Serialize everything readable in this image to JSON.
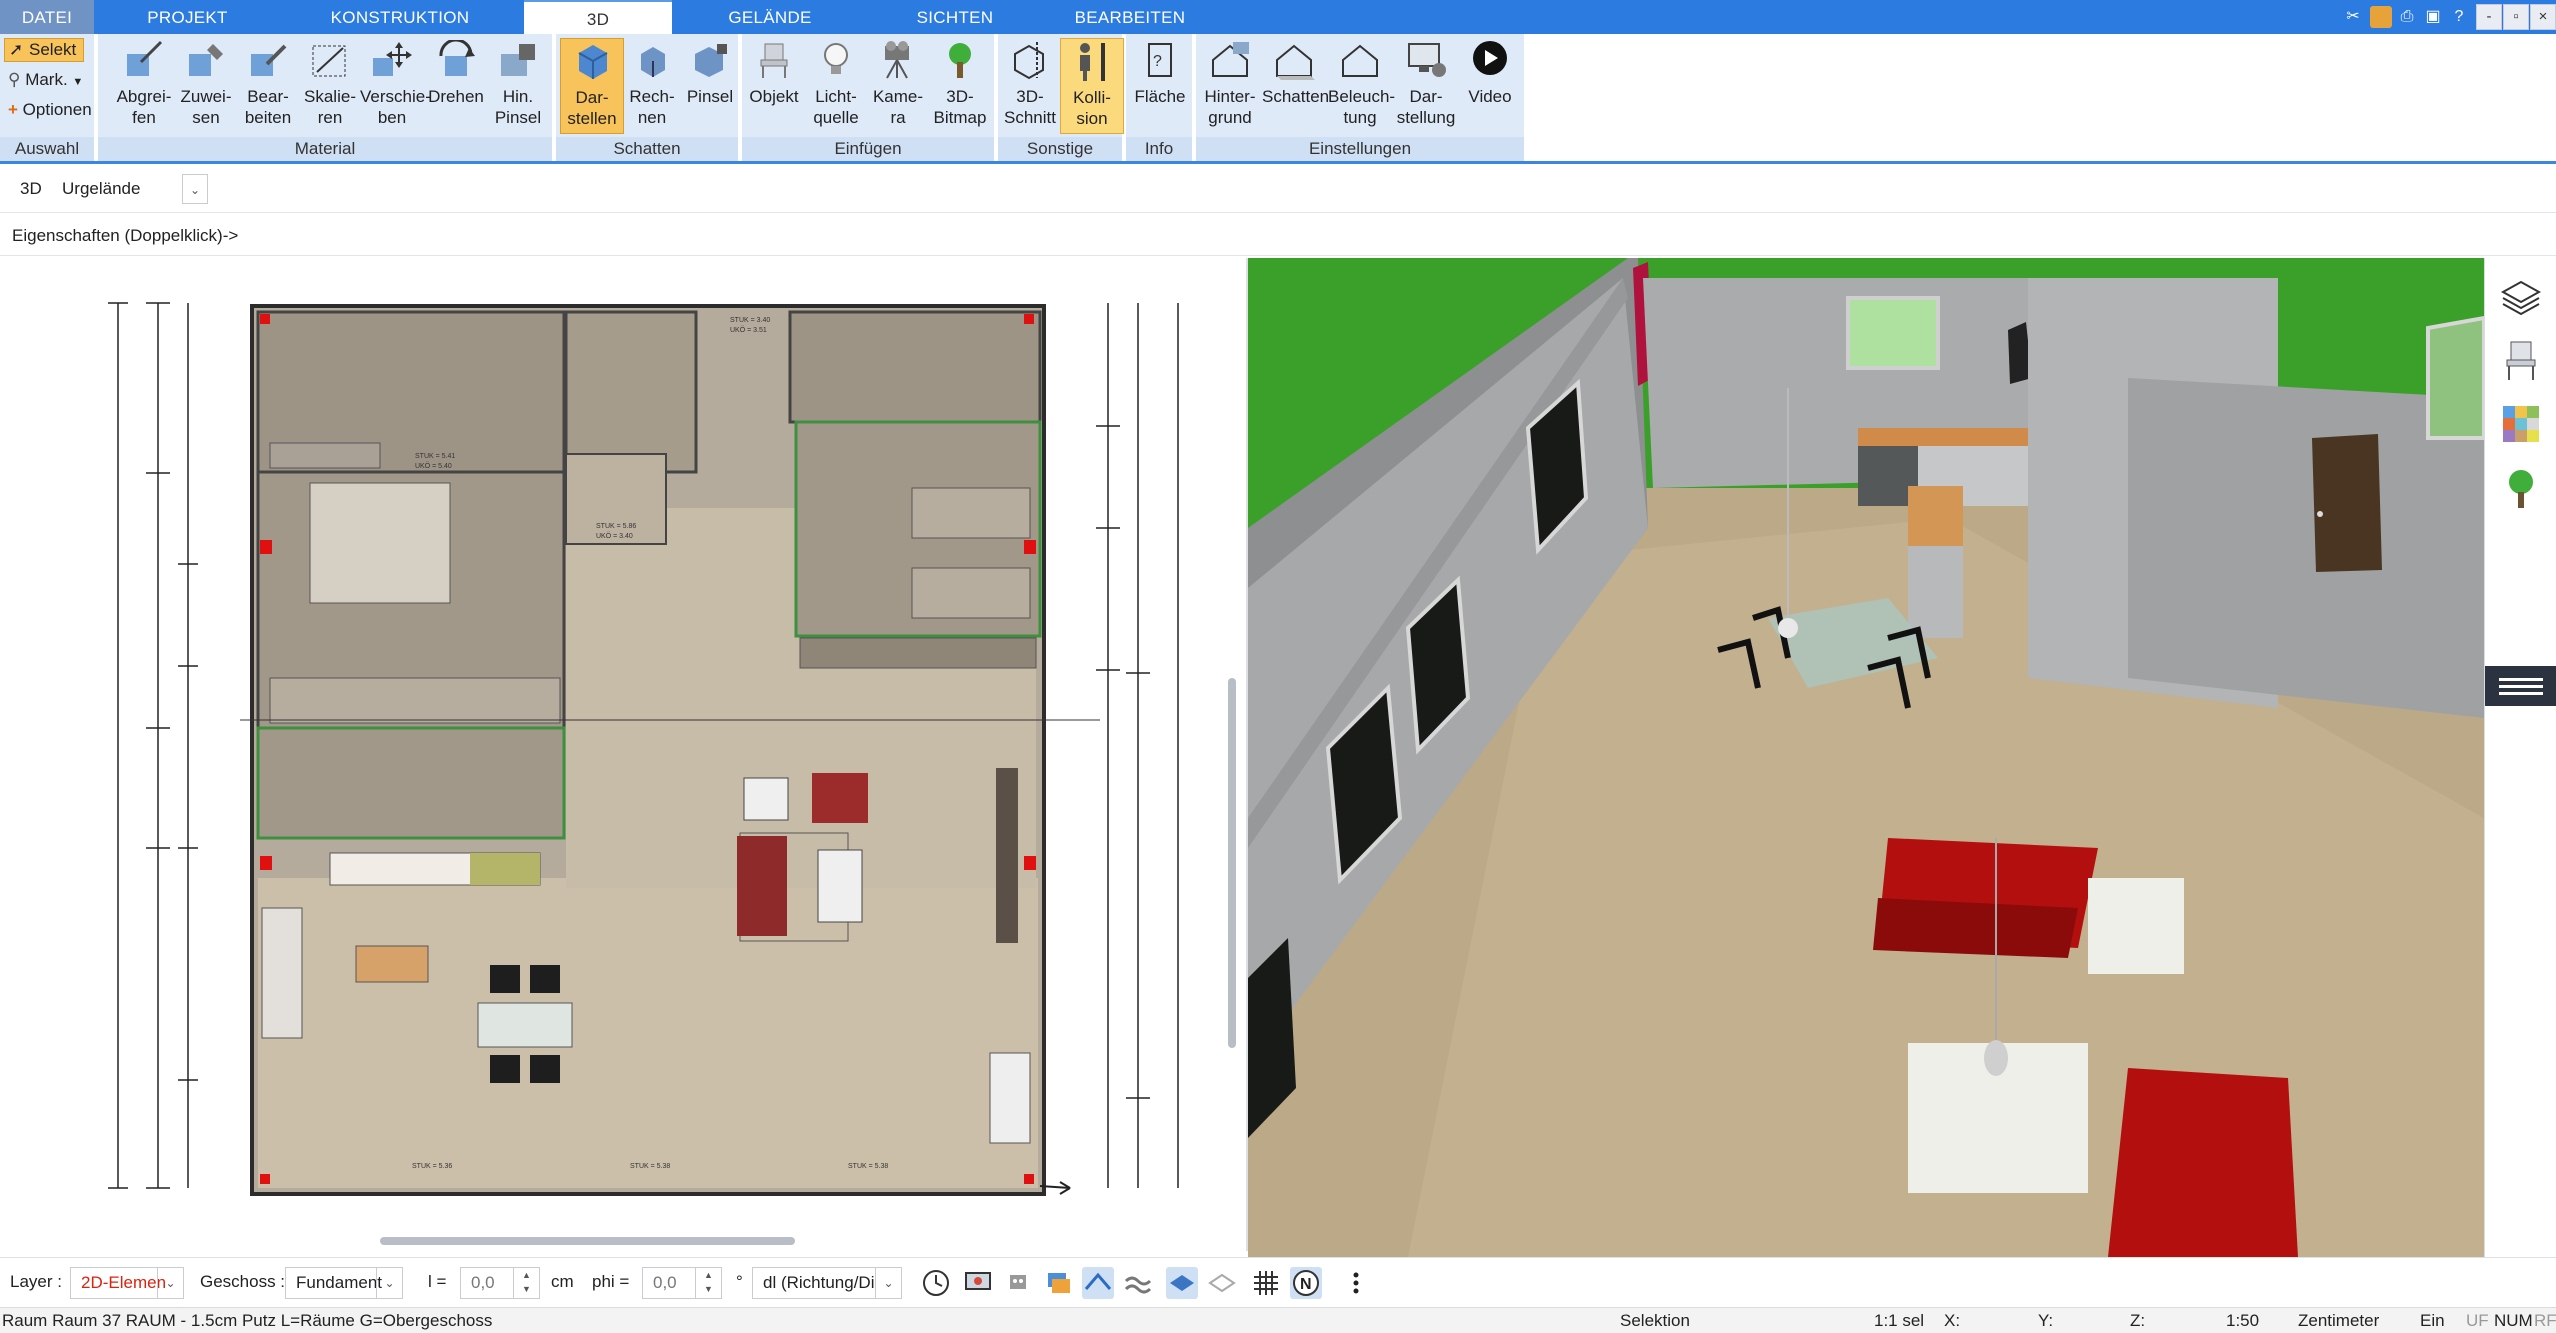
{
  "tabs": [
    {
      "label": "DATEI"
    },
    {
      "label": "PROJEKT"
    },
    {
      "label": "KONSTRUKTION"
    },
    {
      "label": "3D"
    },
    {
      "label": "GELÄNDE"
    },
    {
      "label": "SICHTEN"
    },
    {
      "label": "BEARBEITEN"
    }
  ],
  "window_buttons": {
    "min": "-",
    "restore": "▫",
    "close": "×"
  },
  "ribbon": {
    "auswahl": {
      "label": "Auswahl",
      "selekt": "Selekt",
      "mark": "Mark.",
      "optionen": "Optionen"
    },
    "material": {
      "label": "Material",
      "buttons": [
        "Abgrei-\nfen",
        "Zuwei-\nsen",
        "Bear-\nbeiten",
        "Skalie-\nren",
        "Verschie-\nben",
        "Drehen",
        "Hin.\nPinsel"
      ]
    },
    "schatten": {
      "label": "Schatten",
      "buttons": [
        "Dar-\nstellen",
        "Rech-\nnen",
        "Pinsel"
      ]
    },
    "einfuegen": {
      "label": "Einfügen",
      "buttons": [
        "Objekt",
        "Licht-\nquelle",
        "Kame-\nra",
        "3D-\nBitmap"
      ]
    },
    "sonstige": {
      "label": "Sonstige",
      "buttons": [
        "3D-\nSchnitt",
        "Kolli-\nsion"
      ]
    },
    "info": {
      "label": "Info",
      "buttons": [
        "Fläche"
      ]
    },
    "einstellungen": {
      "label": "Einstellungen",
      "buttons": [
        "Hinter-\ngrund",
        "Schatten",
        "Beleuch-\ntung",
        "Dar-\nstellung",
        "Video"
      ]
    }
  },
  "viewbar": {
    "mode": "3D",
    "terrain": "Urgelände"
  },
  "propsbar": {
    "text": "Eigenschaften (Doppelklick)->"
  },
  "bottom": {
    "layer_label": "Layer :",
    "layer_value": "2D-Elemen",
    "geschoss_label": "Geschoss :",
    "geschoss_value": "Fundament",
    "l_label": "l =",
    "l_value": "0,0",
    "l_unit": "cm",
    "phi_label": "phi =",
    "phi_value": "0,0",
    "phi_unit": "°",
    "dl_value": "dl (Richtung/Di"
  },
  "status": {
    "info": "Raum Raum 37 RAUM - 1.5cm Putz L=Räume G=Obergeschoss",
    "mode": "Selektion",
    "sel": "1:1 sel",
    "x": "X:",
    "y": "Y:",
    "z": "Z:",
    "scale": "1:50",
    "unit": "Zentimeter",
    "ein": "Ein",
    "flags": [
      "UF",
      "NUM",
      "RF"
    ]
  },
  "plan_labels": [
    "STUK = 3.40",
    "UKÖ = 3.51",
    "STUK = 5.41",
    "UKÖ = 5.40",
    "STUK = 5.86",
    "UKÖ = 3.40",
    "STUK = 5.36",
    "STUK = 5.38",
    "STUK = 5.38"
  ],
  "colors": {
    "accent": "#2b7be0",
    "ribbon_bg": "#dfeaf8",
    "selected": "#f7c35a",
    "lawn": "#3aa02a"
  }
}
